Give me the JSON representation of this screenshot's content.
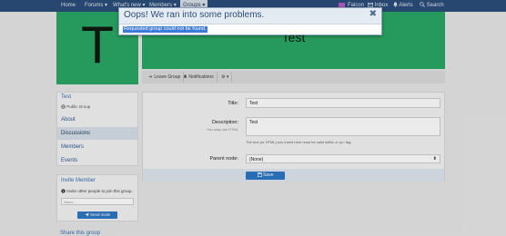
{
  "nav": {
    "items": [
      "Home",
      "Forums",
      "What's new",
      "Members",
      "Groups"
    ],
    "user": "Falcon",
    "inbox": "Inbox",
    "alerts": "Alerts",
    "search": "Search",
    "dropdown_glyph": "▾"
  },
  "group": {
    "avatar_letter": "T",
    "banner_title": "Test",
    "tabs": [
      "Leave Group",
      "Notifications",
      "⚙ ▾"
    ]
  },
  "sidebar": {
    "title": "Test",
    "subtitle": "Public Group",
    "links": [
      "About",
      "Discussions",
      "Members",
      "Events"
    ]
  },
  "invite": {
    "title": "Invite Member",
    "note": "Invite other people to join this group.",
    "placeholder": "Name...",
    "button": "Send invite"
  },
  "share": {
    "title": "Share this group"
  },
  "form": {
    "title_label": "Title:",
    "title_value": "Test",
    "desc_label": "Description:",
    "desc_hint": "You may use HTML",
    "desc_value": "Test",
    "desc_help": "The text (or HTML) you insert here must be valid within a <p> tag.",
    "parent_label": "Parent node:",
    "parent_value": "(None)",
    "save": "Save"
  },
  "modal": {
    "title": "Oops! We ran into some problems.",
    "close_glyph": "✖",
    "message": "Requested group could not be found."
  },
  "colors": {
    "accent": "#2b4e7a",
    "group_green": "#2aa664",
    "button_blue": "#2d77c4"
  }
}
